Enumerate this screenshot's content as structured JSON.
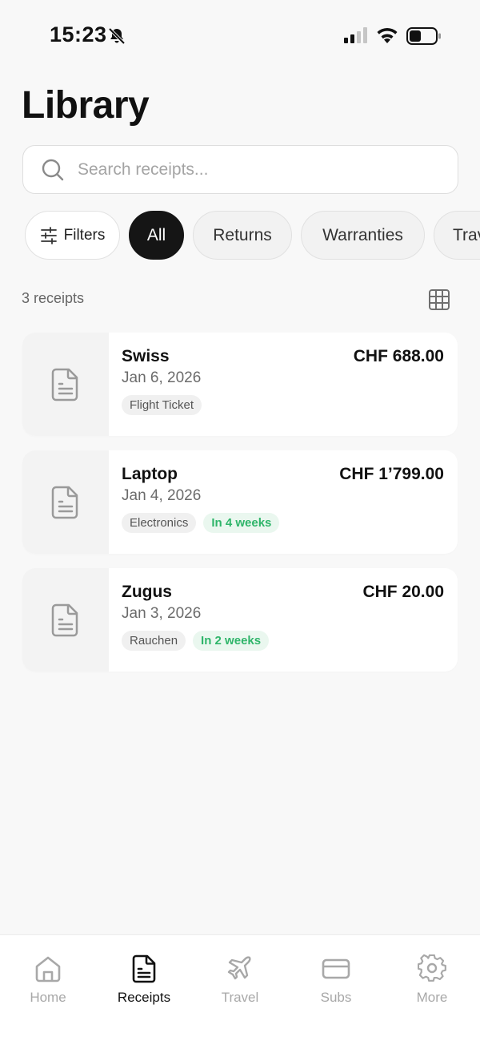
{
  "status_bar": {
    "time": "15:23"
  },
  "header": {
    "title": "Library"
  },
  "search": {
    "placeholder": "Search receipts..."
  },
  "filter_chips": {
    "filters_label": "Filters",
    "items": [
      "All",
      "Returns",
      "Warranties",
      "Travel"
    ],
    "selected": "All"
  },
  "list": {
    "count_text": "3 receipts",
    "receipts": [
      {
        "name": "Swiss",
        "date": "Jan 6, 2026",
        "amount": "CHF 688.00",
        "category": "Flight Ticket",
        "reminder": ""
      },
      {
        "name": "Laptop",
        "date": "Jan 4, 2026",
        "amount": "CHF 1’799.00",
        "category": "Electronics",
        "reminder": "In 4 weeks"
      },
      {
        "name": "Zugus",
        "date": "Jan 3, 2026",
        "amount": "CHF 20.00",
        "category": "Rauchen",
        "reminder": "In 2 weeks"
      }
    ]
  },
  "tab_bar": {
    "items": [
      {
        "label": "Home",
        "icon": "home-icon"
      },
      {
        "label": "Receipts",
        "icon": "receipt-icon"
      },
      {
        "label": "Travel",
        "icon": "plane-icon"
      },
      {
        "label": "Subs",
        "icon": "card-icon"
      },
      {
        "label": "More",
        "icon": "gear-icon"
      }
    ],
    "active": "Receipts"
  },
  "colors": {
    "background": "#f8f8f8",
    "active_chip": "#151515",
    "reminder_green": "#2fb56a",
    "inactive_tab": "#a8a8a8"
  }
}
